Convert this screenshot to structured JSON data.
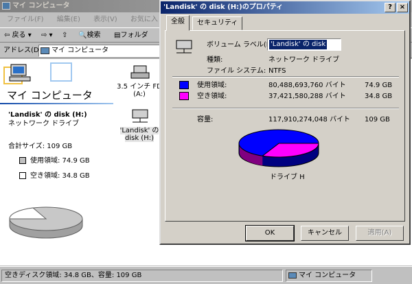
{
  "explorer": {
    "title": "マイ コンピュータ",
    "menu": [
      "ファイル(F)",
      "編集(E)",
      "表示(V)",
      "お気に入り(A)"
    ],
    "toolbar": {
      "back": "戻る",
      "search": "検索",
      "folders": "フォルダ"
    },
    "address_label": "アドレス(D)",
    "address_value": "マイ コンピュータ",
    "pane_title": "マイ コンピュータ",
    "drive_name": "'Landisk' の disk (H:)",
    "drive_type": "ネットワーク ドライブ",
    "total_size": "合計サイズ: 109 GB",
    "used_label": "使用領域: 74.9 GB",
    "free_label": "空き領域: 34.8 GB",
    "icons": [
      {
        "label1": "3.5 インチ FD",
        "label2": "(A:)"
      },
      {
        "label1": "'Landisk' の",
        "label2": "disk (H:)"
      }
    ],
    "status_left": "空きディスク領域: 34.8 GB、容量: 109 GB",
    "status_right": "マイ コンピュータ"
  },
  "dialog": {
    "title": "'Landisk' の disk (H:)のプロパティ",
    "help_btn": "?",
    "close_btn": "×",
    "tabs": [
      "全般",
      "セキュリティ"
    ],
    "volume_label_caption": "ボリューム ラベル(L):",
    "volume_label_value": "'Landisk' の disk",
    "type_caption": "種類:",
    "type_value": "ネットワーク ドライブ",
    "fs_caption": "ファイル システム:",
    "fs_value": "NTFS",
    "used_caption": "使用領域:",
    "used_bytes": "80,488,693,760 バイト",
    "used_gb": "74.9 GB",
    "free_caption": "空き領域:",
    "free_bytes": "37,421,580,288 バイト",
    "free_gb": "34.8 GB",
    "cap_caption": "容量:",
    "cap_bytes": "117,910,274,048 バイト",
    "cap_gb": "109 GB",
    "drive_caption": "ドライブ H",
    "used_fraction": 0.683,
    "used_color": "#0000ff",
    "free_color": "#ff00ff",
    "buttons": {
      "ok": "OK",
      "cancel": "キャンセル",
      "apply": "適用(A)"
    }
  }
}
